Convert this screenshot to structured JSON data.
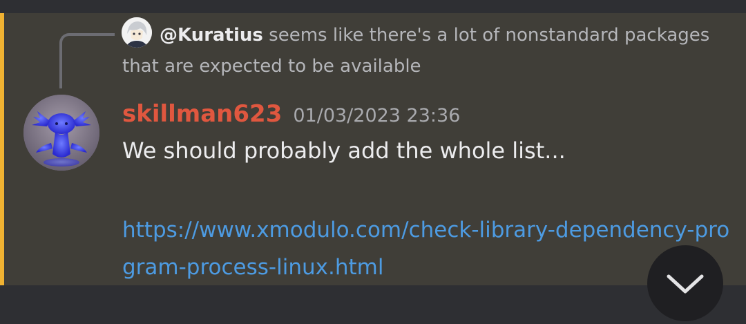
{
  "reply": {
    "author": "@Kuratius",
    "text": "seems like there's a lot of nonstandard packages that are expected to be available"
  },
  "message": {
    "username": "skillman623",
    "timestamp": "01/03/2023 23:36",
    "text": "We should probably add the whole list...",
    "link": "https://www.xmodulo.com/check-library-dependency-program-process-linux.html"
  },
  "colors": {
    "highlight_bar": "#f0b232",
    "username": "#e0573f",
    "link": "#4d9be2",
    "message_background": "#403e38"
  },
  "icons": {
    "scroll_button": "chevron-down-icon"
  }
}
